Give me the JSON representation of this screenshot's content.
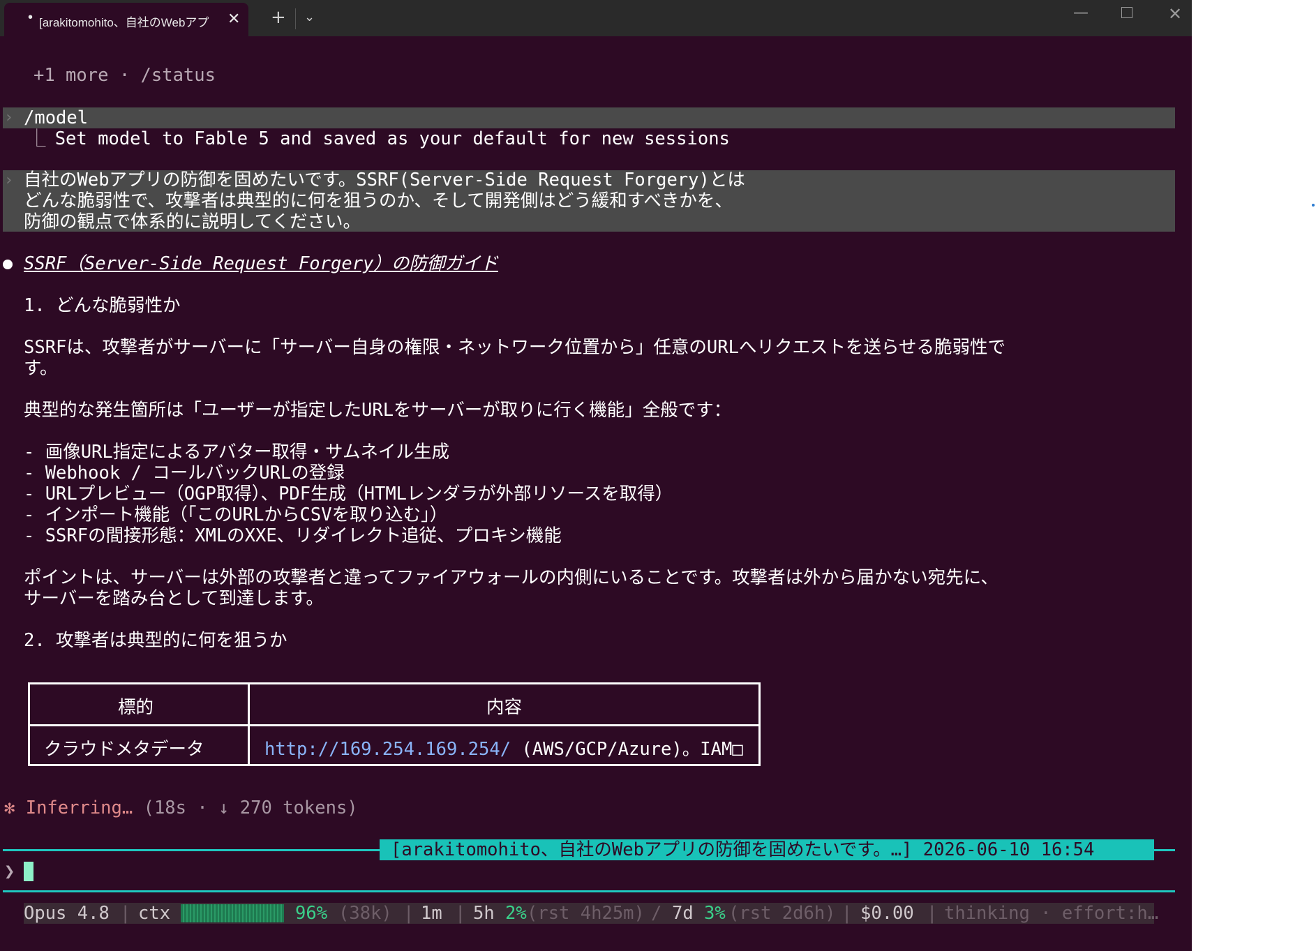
{
  "window": {
    "tab_dot": "•",
    "tab_title": "[arakitomohito、自社のWebアプ",
    "tab_close": "✕",
    "new_tab": "+",
    "dropdown": "⌄",
    "minimize": "—",
    "close": "✕"
  },
  "terminal": {
    "more_status": "+1 more · /status",
    "cmd_model": "/model",
    "model_result": "  Set model to Fable 5 and saved as your default for new sessions",
    "prompt_lines": [
      "自社のWebアプリの防御を固めたいです。SSRF(Server-Side Request Forgery)とは",
      "どんな脆弱性で、攻撃者は典型的に何を狙うのか、そして開発側はどう緩和すべきかを、",
      "防御の観点で体系的に説明してください。"
    ],
    "heading": "SSRF（Server-Side Request Forgery）の防御ガイド",
    "sec1": "1. どんな脆弱性か",
    "para1_lines": [
      "SSRFは、攻撃者がサーバーに「サーバー自身の権限・ネットワーク位置から」任意のURLへリクエストを送らせる脆弱性で",
      "す。"
    ],
    "para2": "典型的な発生箇所は「ユーザーが指定したURLをサーバーが取りに行く機能」全般です：",
    "bullets": [
      "- 画像URL指定によるアバター取得・サムネイル生成",
      "- Webhook / コールバックURLの登録",
      "- URLプレビュー（OGP取得）、PDF生成（HTMLレンダラが外部リソースを取得）",
      "- インポート機能（「このURLからCSVを取り込む」）",
      "- SSRFの間接形態：XMLのXXE、リダイレクト追従、プロキシ機能"
    ],
    "para3_lines": [
      "ポイントは、サーバーは外部の攻撃者と違ってファイアウォールの内側にいることです。攻撃者は外から届かない宛先に、",
      "サーバーを踏み台として到達します。"
    ],
    "sec2": "2. 攻撃者は典型的に何を狙うか",
    "table": {
      "headers": [
        "標的",
        "内容"
      ],
      "row": {
        "target": "クラウドメタデータ",
        "link": "http://169.254.169.254/",
        "rest": " (AWS/GCP/Azure)。IAM□"
      }
    },
    "inferring": {
      "icon": "✻",
      "label": "Inferring…",
      "meta": " (18s · ↓ 270 tokens)"
    },
    "session_badge": "[arakitomohito、自社のWebアプリの防御を固めたいです。…] 2026-06-10 16:54",
    "prompt_symbol": "❯"
  },
  "statusbar": {
    "model": "Opus 4.8",
    "sep": "|",
    "ctx_label": "ctx",
    "ctx_fill": 0.96,
    "ctx_pct": "96%",
    "ctx_tokens": "(38k)",
    "time": "1m",
    "win5h": "5h",
    "win5h_pct": "2%",
    "win5h_rst": "(rst 4h25m)",
    "slash": "/",
    "win7d": "7d",
    "win7d_pct": "3%",
    "win7d_rst": "(rst 2d6h)",
    "cost": "$0.00",
    "thinking": "thinking · effort:h…"
  },
  "colors": {
    "background": "#2d0a24",
    "accent": "#19c2b8",
    "link": "#8ab4f8",
    "inferring": "#e08a8a",
    "good": "#3ad08a"
  }
}
